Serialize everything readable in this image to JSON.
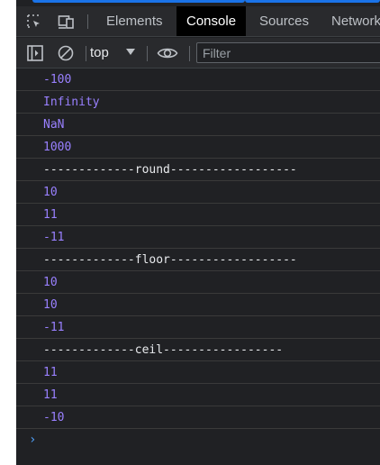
{
  "tabs": [
    {
      "label": "Elements",
      "active": false
    },
    {
      "label": "Console",
      "active": true
    },
    {
      "label": "Sources",
      "active": false
    },
    {
      "label": "Network",
      "active": false
    }
  ],
  "toolbar": {
    "context": "top",
    "filter_placeholder": "Filter",
    "filter_value": ""
  },
  "console": {
    "rows": [
      {
        "text": "-100",
        "kind": "number"
      },
      {
        "text": "Infinity",
        "kind": "number"
      },
      {
        "text": "NaN",
        "kind": "number"
      },
      {
        "text": "1000",
        "kind": "number"
      },
      {
        "text": "-------------round------------------",
        "kind": "string"
      },
      {
        "text": "10",
        "kind": "number"
      },
      {
        "text": "11",
        "kind": "number"
      },
      {
        "text": "-11",
        "kind": "number"
      },
      {
        "text": "-------------floor------------------",
        "kind": "string"
      },
      {
        "text": "10",
        "kind": "number"
      },
      {
        "text": "10",
        "kind": "number"
      },
      {
        "text": "-11",
        "kind": "number"
      },
      {
        "text": "-------------ceil-----------------",
        "kind": "string"
      },
      {
        "text": "11",
        "kind": "number"
      },
      {
        "text": "11",
        "kind": "number"
      },
      {
        "text": "-10",
        "kind": "number"
      }
    ],
    "prompt": "›"
  },
  "colors": {
    "number": "#9980ff",
    "string": "#e8eaed",
    "prompt": "#4f9ff7",
    "background": "#202124",
    "active_tab": "#000000"
  },
  "icons": [
    "inspect-element-icon",
    "device-toolbar-icon",
    "sidebar-toggle-icon",
    "clear-console-icon",
    "eye-icon",
    "dropdown-arrow-icon",
    "prompt-chevron-icon"
  ]
}
